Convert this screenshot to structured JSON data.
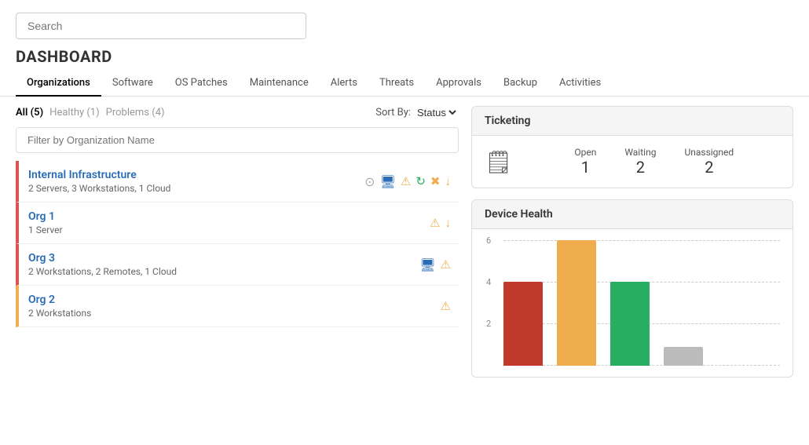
{
  "search": {
    "placeholder": "Search"
  },
  "dashboard": {
    "title": "DASHBOARD",
    "tabs": [
      {
        "id": "organizations",
        "label": "Organizations",
        "active": true
      },
      {
        "id": "software",
        "label": "Software",
        "active": false
      },
      {
        "id": "os-patches",
        "label": "OS Patches",
        "active": false
      },
      {
        "id": "maintenance",
        "label": "Maintenance",
        "active": false
      },
      {
        "id": "alerts",
        "label": "Alerts",
        "active": false
      },
      {
        "id": "threats",
        "label": "Threats",
        "active": false
      },
      {
        "id": "approvals",
        "label": "Approvals",
        "active": false
      },
      {
        "id": "backup",
        "label": "Backup",
        "active": false
      },
      {
        "id": "activities",
        "label": "Activities",
        "active": false
      }
    ]
  },
  "filter": {
    "tabs": [
      {
        "id": "all",
        "label": "All (5)",
        "active": true
      },
      {
        "id": "healthy",
        "label": "Healthy (1)",
        "active": false
      },
      {
        "id": "problems",
        "label": "Problems (4)",
        "active": false
      }
    ],
    "sort_label": "Sort By:",
    "sort_value": "Status",
    "filter_placeholder": "Filter by Organization Name"
  },
  "organizations": [
    {
      "id": "internal-infrastructure",
      "name": "Internal Infrastructure",
      "details": "2 Servers, 3 Workstations, 1 Cloud",
      "status": "red",
      "icons": [
        "dots-circle",
        "monitor",
        "warning",
        "refresh",
        "cross",
        "down-arrow"
      ]
    },
    {
      "id": "org1",
      "name": "Org 1",
      "details": "1 Server",
      "status": "red",
      "icons": [
        "warning",
        "down-arrow"
      ]
    },
    {
      "id": "org3",
      "name": "Org 3",
      "details": "2 Workstations, 2 Remotes, 1 Cloud",
      "status": "red",
      "icons": [
        "monitor",
        "warning"
      ]
    },
    {
      "id": "org2",
      "name": "Org 2",
      "details": "2 Workstations",
      "status": "yellow",
      "icons": [
        "warning"
      ]
    }
  ],
  "ticketing": {
    "title": "Ticketing",
    "icon": "📄",
    "stats": [
      {
        "label": "Open",
        "value": "1"
      },
      {
        "label": "Waiting",
        "value": "2"
      },
      {
        "label": "Unassigned",
        "value": "2"
      }
    ]
  },
  "device_health": {
    "title": "Device Health",
    "chart": {
      "y_labels": [
        "6",
        "4",
        "2"
      ],
      "bars": [
        {
          "color": "red",
          "height_pct": 67,
          "label": ""
        },
        {
          "color": "yellow",
          "height_pct": 100,
          "label": ""
        },
        {
          "color": "green",
          "height_pct": 67,
          "label": ""
        },
        {
          "color": "gray",
          "height_pct": 15,
          "label": ""
        }
      ]
    }
  }
}
